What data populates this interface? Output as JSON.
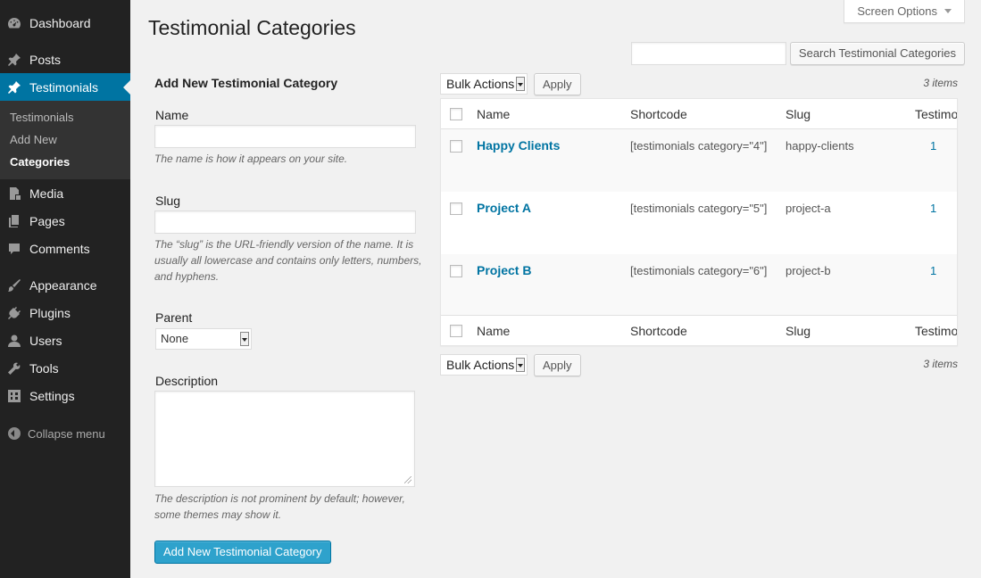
{
  "sidebar": {
    "items": [
      {
        "label": "Dashboard",
        "icon": "dashboard-icon"
      },
      {
        "label": "Posts",
        "icon": "pin-icon"
      },
      {
        "label": "Testimonials",
        "icon": "pin-icon"
      },
      {
        "label": "Media",
        "icon": "media-icon"
      },
      {
        "label": "Pages",
        "icon": "pages-icon"
      },
      {
        "label": "Comments",
        "icon": "comment-icon"
      },
      {
        "label": "Appearance",
        "icon": "brush-icon"
      },
      {
        "label": "Plugins",
        "icon": "plug-icon"
      },
      {
        "label": "Users",
        "icon": "user-icon"
      },
      {
        "label": "Tools",
        "icon": "wrench-icon"
      },
      {
        "label": "Settings",
        "icon": "settings-icon"
      }
    ],
    "submenu": [
      "Testimonials",
      "Add New",
      "Categories"
    ],
    "collapse_label": "Collapse menu"
  },
  "header": {
    "title": "Testimonial Categories",
    "screen_options": "Screen Options",
    "search_button": "Search Testimonial Categories",
    "search_value": ""
  },
  "form": {
    "heading": "Add New Testimonial Category",
    "name_label": "Name",
    "name_help": "The name is how it appears on your site.",
    "slug_label": "Slug",
    "slug_help": "The “slug” is the URL-friendly version of the name. It is usually all lowercase and contains only letters, numbers, and hyphens.",
    "parent_label": "Parent",
    "parent_value": "None",
    "description_label": "Description",
    "description_help": "The description is not prominent by default; however, some themes may show it.",
    "submit_label": "Add New Testimonial Category"
  },
  "table": {
    "bulk_actions": "Bulk Actions",
    "apply": "Apply",
    "count": "3 items",
    "columns": [
      "Name",
      "Shortcode",
      "Slug",
      "Testimo"
    ],
    "rows": [
      {
        "name": "Happy Clients",
        "shortcode": "[testimonials category=\"4\"]",
        "slug": "happy-clients",
        "count": "1"
      },
      {
        "name": "Project A",
        "shortcode": "[testimonials category=\"5\"]",
        "slug": "project-a",
        "count": "1"
      },
      {
        "name": "Project B",
        "shortcode": "[testimonials category=\"6\"]",
        "slug": "project-b",
        "count": "1"
      }
    ]
  },
  "colors": {
    "sidebar_bg": "#222222",
    "accent": "#0074a2",
    "primary_button": "#2ea2cc"
  }
}
